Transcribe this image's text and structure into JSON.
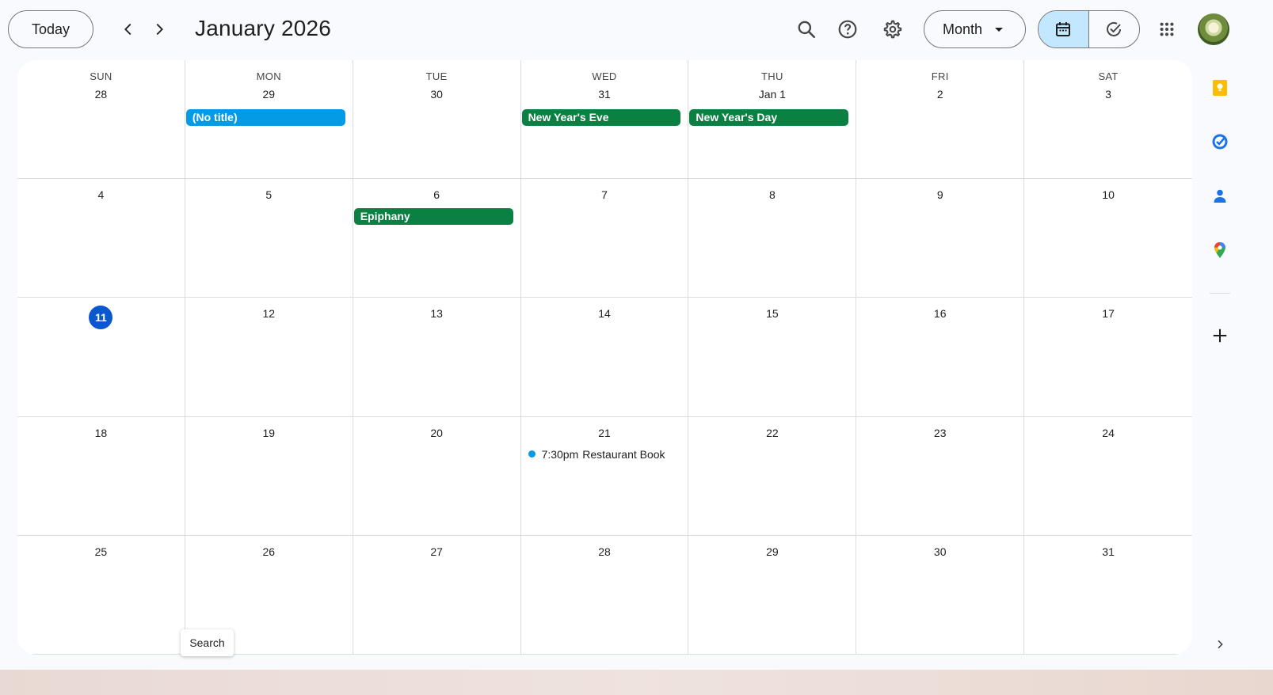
{
  "header": {
    "today_label": "Today",
    "title": "January 2026",
    "view_label": "Month",
    "icons": [
      "chevron-left-icon",
      "chevron-right-icon",
      "search-icon",
      "help-icon",
      "settings-icon",
      "calendar-icon",
      "task-check-icon",
      "apps-grid-icon"
    ]
  },
  "weekdays": [
    "SUN",
    "MON",
    "TUE",
    "WED",
    "THU",
    "FRI",
    "SAT"
  ],
  "weeks": [
    [
      "28",
      "29",
      "30",
      "31",
      "Jan 1",
      "2",
      "3"
    ],
    [
      "4",
      "5",
      "6",
      "7",
      "8",
      "9",
      "10"
    ],
    [
      "11",
      "12",
      "13",
      "14",
      "15",
      "16",
      "17"
    ],
    [
      "18",
      "19",
      "20",
      "21",
      "22",
      "23",
      "24"
    ],
    [
      "25",
      "26",
      "27",
      "28",
      "29",
      "30",
      "31"
    ]
  ],
  "today": "11",
  "events": {
    "no_title": "(No title)",
    "new_years_eve": "New Year's Eve",
    "new_years_day": "New Year's Day",
    "epiphany": "Epiphany",
    "restaurant_time": "7:30pm",
    "restaurant_title": "Restaurant Book"
  },
  "colors": {
    "blue_event": "#039be5",
    "green_event": "#0b8043",
    "today_circle": "#0b57d0",
    "active_toggle": "#c2e7ff"
  },
  "tooltip": "Search",
  "side_panel": [
    "keep-icon",
    "tasks-icon",
    "contacts-icon",
    "maps-icon",
    "add-icon"
  ]
}
